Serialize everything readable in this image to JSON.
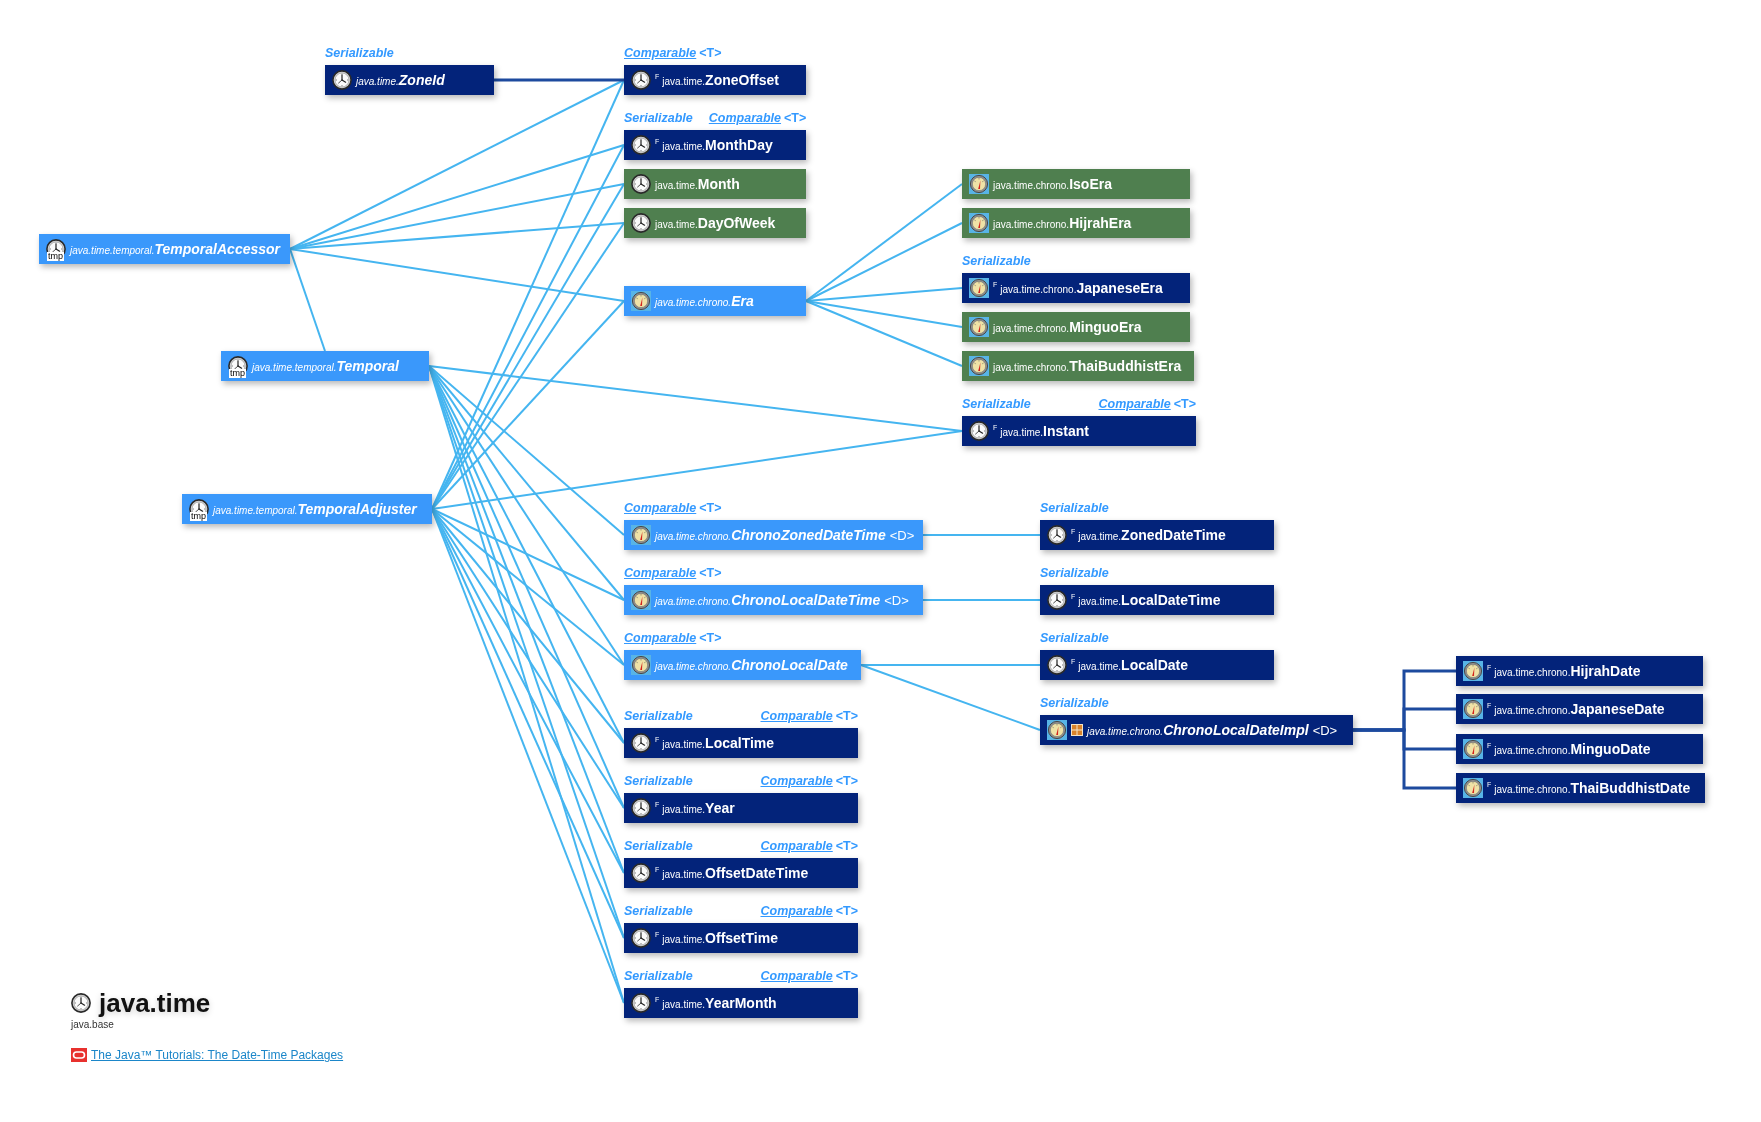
{
  "nodes": [
    {
      "package": "java.time.",
      "name": "ZoneId",
      "kind": "abstract_class",
      "extra_icon": false,
      "labels": [
        {
          "text": "Serializable",
          "link": false
        }
      ]
    },
    {
      "package": "java.time.temporal.",
      "name": "TemporalAccessor",
      "kind": "interface",
      "icon_text": "tmp",
      "extra_icon": false
    },
    {
      "package": "java.time.temporal.",
      "name": "Temporal",
      "kind": "interface",
      "icon_text": "tmp",
      "extra_icon": false
    },
    {
      "package": "java.time.temporal.",
      "name": "TemporalAdjuster",
      "kind": "interface",
      "icon_text": "tmp",
      "extra_icon": false
    },
    {
      "package": "java.time.",
      "name": "ZoneOffset",
      "kind": "class",
      "final_mark": "F",
      "extra_icon": false,
      "labels": [
        {
          "text": "Comparable",
          "link": true,
          "type_params": "<T>"
        }
      ]
    },
    {
      "package": "java.time.",
      "name": "MonthDay",
      "kind": "class",
      "final_mark": "F",
      "extra_icon": false,
      "labels": [
        {
          "text": "Serializable",
          "link": false
        },
        {
          "text": "Comparable",
          "link": true,
          "type_params": "<T>"
        }
      ]
    },
    {
      "package": "java.time.",
      "name": "Month",
      "kind": "enum",
      "extra_icon": false
    },
    {
      "package": "java.time.",
      "name": "DayOfWeek",
      "kind": "enum",
      "extra_icon": false
    },
    {
      "package": "java.time.chrono.",
      "name": "Era",
      "kind": "interface",
      "extra_icon": false
    },
    {
      "package": "java.time.chrono.",
      "name": "ChronoZonedDateTime",
      "type_params": "<D>",
      "kind": "interface",
      "extra_icon": false,
      "labels": [
        {
          "text": "Comparable",
          "link": true,
          "type_params": "<T>"
        }
      ]
    },
    {
      "package": "java.time.chrono.",
      "name": "ChronoLocalDateTime",
      "type_params": "<D>",
      "kind": "interface",
      "extra_icon": false,
      "labels": [
        {
          "text": "Comparable",
          "link": true,
          "type_params": "<T>"
        }
      ]
    },
    {
      "package": "java.time.chrono.",
      "name": "ChronoLocalDate",
      "kind": "interface",
      "extra_icon": false,
      "labels": [
        {
          "text": "Comparable",
          "link": true,
          "type_params": "<T>"
        }
      ]
    },
    {
      "package": "java.time.",
      "name": "LocalTime",
      "kind": "class",
      "final_mark": "F",
      "extra_icon": false,
      "labels": [
        {
          "text": "Serializable",
          "link": false
        },
        {
          "text": "Comparable",
          "link": true,
          "type_params": "<T>"
        }
      ]
    },
    {
      "package": "java.time.",
      "name": "Year",
      "kind": "class",
      "final_mark": "F",
      "extra_icon": false,
      "labels": [
        {
          "text": "Serializable",
          "link": false
        },
        {
          "text": "Comparable",
          "link": true,
          "type_params": "<T>"
        }
      ]
    },
    {
      "package": "java.time.",
      "name": "OffsetDateTime",
      "kind": "class",
      "final_mark": "F",
      "extra_icon": false,
      "labels": [
        {
          "text": "Serializable",
          "link": false
        },
        {
          "text": "Comparable",
          "link": true,
          "type_params": "<T>"
        }
      ]
    },
    {
      "package": "java.time.",
      "name": "OffsetTime",
      "kind": "class",
      "final_mark": "F",
      "extra_icon": false,
      "labels": [
        {
          "text": "Serializable",
          "link": false
        },
        {
          "text": "Comparable",
          "link": true,
          "type_params": "<T>"
        }
      ]
    },
    {
      "package": "java.time.",
      "name": "YearMonth",
      "kind": "class",
      "final_mark": "F",
      "extra_icon": false,
      "labels": [
        {
          "text": "Serializable",
          "link": false
        },
        {
          "text": "Comparable",
          "link": true,
          "type_params": "<T>"
        }
      ]
    },
    {
      "package": "java.time.chrono.",
      "name": "IsoEra",
      "kind": "enum",
      "extra_icon": false
    },
    {
      "package": "java.time.chrono.",
      "name": "HijrahEra",
      "kind": "enum",
      "extra_icon": false
    },
    {
      "package": "java.time.chrono.",
      "name": "JapaneseEra",
      "kind": "class",
      "final_mark": "F",
      "extra_icon": false,
      "labels": [
        {
          "text": "Serializable",
          "link": false
        }
      ]
    },
    {
      "package": "java.time.chrono.",
      "name": "MinguoEra",
      "kind": "enum",
      "extra_icon": false
    },
    {
      "package": "java.time.chrono.",
      "name": "ThaiBuddhistEra",
      "kind": "enum",
      "extra_icon": false
    },
    {
      "package": "java.time.",
      "name": "Instant",
      "kind": "class",
      "final_mark": "F",
      "extra_icon": false,
      "labels": [
        {
          "text": "Serializable",
          "link": false
        },
        {
          "text": "Comparable",
          "link": true,
          "type_params": "<T>"
        }
      ]
    },
    {
      "package": "java.time.",
      "name": "ZonedDateTime",
      "kind": "class",
      "final_mark": "F",
      "extra_icon": false,
      "labels": [
        {
          "text": "Serializable",
          "link": false
        }
      ]
    },
    {
      "package": "java.time.",
      "name": "LocalDateTime",
      "kind": "class",
      "final_mark": "F",
      "extra_icon": false,
      "labels": [
        {
          "text": "Serializable",
          "link": false
        }
      ]
    },
    {
      "package": "java.time.",
      "name": "LocalDate",
      "kind": "class",
      "final_mark": "F",
      "extra_icon": false,
      "labels": [
        {
          "text": "Serializable",
          "link": false
        }
      ]
    },
    {
      "package": "java.time.chrono.",
      "name": "ChronoLocalDateImpl",
      "type_params": "<D>",
      "kind": "abstract_class",
      "extra_icon": true,
      "labels": [
        {
          "text": "Serializable",
          "link": false
        }
      ]
    },
    {
      "package": "java.time.chrono.",
      "name": "HijrahDate",
      "kind": "class",
      "final_mark": "F",
      "extra_icon": false
    },
    {
      "package": "java.time.chrono.",
      "name": "JapaneseDate",
      "kind": "class",
      "final_mark": "F",
      "extra_icon": false
    },
    {
      "package": "java.time.chrono.",
      "name": "MinguoDate",
      "kind": "class",
      "final_mark": "F",
      "extra_icon": false
    },
    {
      "package": "java.time.chrono.",
      "name": "ThaiBuddhistDate",
      "kind": "class",
      "final_mark": "F",
      "extra_icon": false
    }
  ],
  "package": {
    "title": "java.time",
    "module": "java.base",
    "link": {
      "text": "The Java™ Tutorials: The Date-Time Packages"
    }
  }
}
